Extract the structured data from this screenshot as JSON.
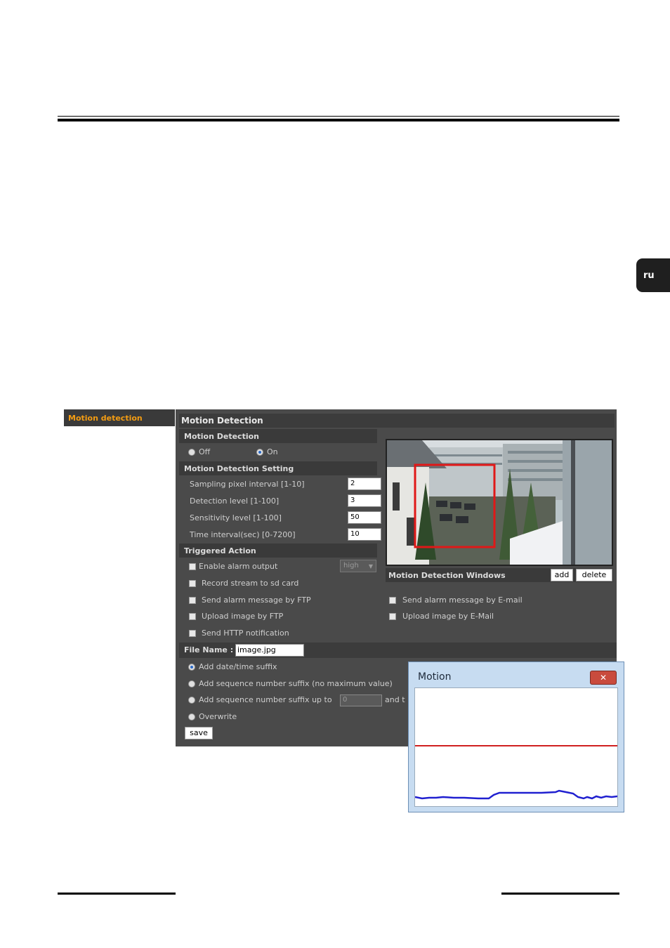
{
  "page": {
    "lang_tab": "ru"
  },
  "sidebar": {
    "items": [
      {
        "label": "Motion detection",
        "color": "#f39c12"
      }
    ]
  },
  "panel": {
    "title": "Motion Detection",
    "motion_detection": {
      "heading": "Motion Detection",
      "off_label": "Off",
      "on_label": "On",
      "selected": "On"
    },
    "setting": {
      "heading": "Motion Detection Setting",
      "fields": [
        {
          "label": "Sampling pixel interval [1-10]",
          "value": "2"
        },
        {
          "label": "Detection level [1-100]",
          "value": "3"
        },
        {
          "label": "Sensitivity level [1-100]",
          "value": "50"
        },
        {
          "label": "Time interval(sec) [0-7200]",
          "value": "10"
        }
      ]
    },
    "triggered": {
      "heading": "Triggered Action",
      "alarm_output_label": "Enable alarm output",
      "alarm_output_select": "high",
      "record_sd": "Record stream to sd card",
      "alarm_ftp": "Send alarm message by FTP",
      "upload_ftp": "Upload image by FTP",
      "http_notify": "Send HTTP notification",
      "alarm_email": "Send alarm message by E-mail",
      "upload_email": "Upload image by E-Mail"
    },
    "windows": {
      "label": "Motion Detection Windows",
      "add_label": "add",
      "delete_label": "delete"
    },
    "file": {
      "label": "File Name :",
      "value": "image.jpg",
      "opt_datetime": "Add date/time suffix",
      "opt_seq_nomax": "Add sequence number suffix (no maximum value)",
      "opt_seq_upto": "Add sequence number suffix up to",
      "seq_upto_value": "0",
      "seq_upto_tail": "and t",
      "opt_overwrite": "Overwrite",
      "selected": "Add date/time suffix",
      "save_label": "save"
    }
  },
  "popup": {
    "title": "Motion",
    "close_label": "✕",
    "threshold_color": "#d02020",
    "level_color": "#2020d0"
  }
}
